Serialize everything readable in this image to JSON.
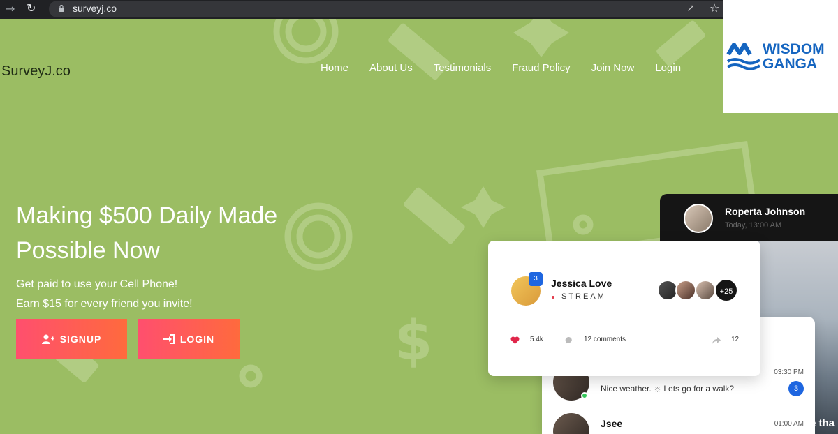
{
  "browser": {
    "url": "surveyj.co",
    "icons": [
      "forward-arrow-icon",
      "reload-icon",
      "lock-icon",
      "share-icon",
      "star-icon"
    ]
  },
  "watermark": {
    "line1": "WISDOM",
    "line2": "GANGA",
    "colors": {
      "text": "#1565c0",
      "waves": "#1565c0"
    }
  },
  "header": {
    "brand": "SurveyJ.co",
    "nav": [
      "Home",
      "About Us",
      "Testimonials",
      "Fraud Policy",
      "Join Now",
      "Login"
    ]
  },
  "hero": {
    "title_line1": "Making $500 Daily Made",
    "title_line2": "Possible Now",
    "sub_line1": "Get paid to use your Cell Phone!",
    "sub_line2": "Earn $15 for every friend you invite!",
    "signup_label": "SIGNUP",
    "login_label": "LOGIN",
    "button_gradient": [
      "#ff4f6e",
      "#ff6a3d"
    ]
  },
  "dark_card": {
    "name": "Roperta Johnson",
    "time": "Today, 13:00 AM",
    "caption": "e tha"
  },
  "stream_card": {
    "name": "Jessica Love",
    "badge": "3",
    "status": "STREAM",
    "extra_viewers": "+25",
    "likes": "5.4k",
    "comments": "12 comments",
    "shares": "12"
  },
  "chat_card": {
    "messages": [
      {
        "text": "Nice weather. ☼ Lets go for a walk?",
        "time": "03:30 PM",
        "badge": "3",
        "online": true
      },
      {
        "name": "Jsee",
        "time": "01:00 AM"
      }
    ]
  },
  "colors": {
    "background": "#9bbd63",
    "accent_blue": "#1e66e0"
  }
}
